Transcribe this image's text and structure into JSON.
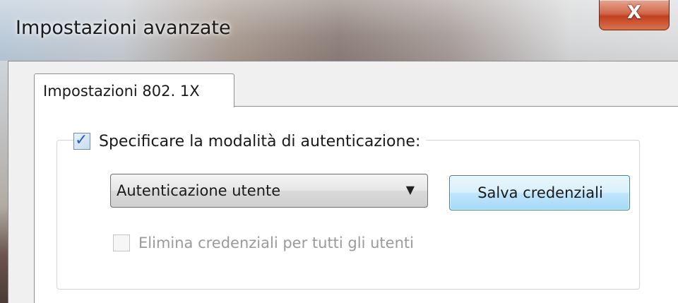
{
  "window": {
    "title": "Impostazioni avanzate",
    "close_glyph": "X"
  },
  "tabs": [
    {
      "label": "Impostazioni 802. 1X",
      "selected": true
    }
  ],
  "auth_group": {
    "checkbox_checked": true,
    "label": "Specificare la modalità di autenticazione:",
    "mode_dropdown": {
      "selected": "Autenticazione utente"
    },
    "save_button_label": "Salva credenziali",
    "delete_checkbox": {
      "label": "Elimina credenziali per tutti gli utenti",
      "checked": false,
      "enabled": false
    }
  },
  "colors": {
    "close_button": "#c2401f",
    "save_button_border": "#3c7fb1",
    "checkmark": "#2b57c9"
  },
  "icons": {
    "close": "close-icon",
    "dropdown": "chevron-down-icon",
    "check": "checkmark-icon"
  }
}
